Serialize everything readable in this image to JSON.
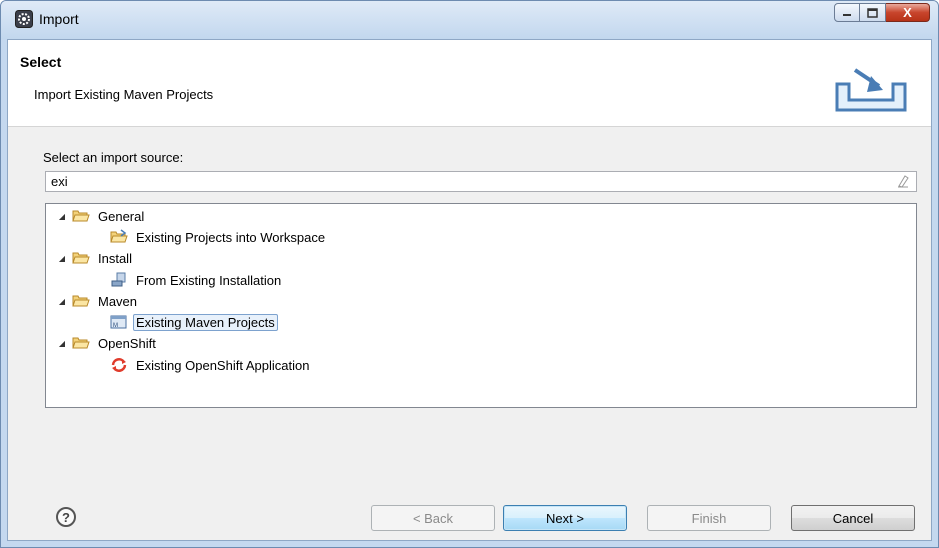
{
  "window": {
    "title": "Import",
    "icon": "eclipse-gear-icon",
    "controls": {
      "minimize": "—",
      "maximize": "▢",
      "close": "X"
    }
  },
  "banner": {
    "title": "Select",
    "description": "Import Existing Maven Projects",
    "icon": "import-tray-icon"
  },
  "source": {
    "label": "Select an import source:",
    "filter_value": "exi"
  },
  "tree": {
    "categories": [
      {
        "label": "General",
        "child": "Existing Projects into Workspace",
        "child_icon": "project-folder-icon"
      },
      {
        "label": "Install",
        "child": "From Existing Installation",
        "child_icon": "installation-icon"
      },
      {
        "label": "Maven",
        "child": "Existing Maven Projects",
        "child_icon": "maven-project-icon"
      },
      {
        "label": "OpenShift",
        "child": "Existing OpenShift Application",
        "child_icon": "openshift-icon"
      }
    ],
    "selected": "Existing Maven Projects"
  },
  "buttons": {
    "help": "?",
    "back": "< Back",
    "next": "Next >",
    "finish": "Finish",
    "cancel": "Cancel"
  },
  "colors": {
    "accent": "#3c7fb1",
    "close_button": "#c8452c",
    "folder": "#e8c060",
    "openshift": "#e03c2c"
  }
}
